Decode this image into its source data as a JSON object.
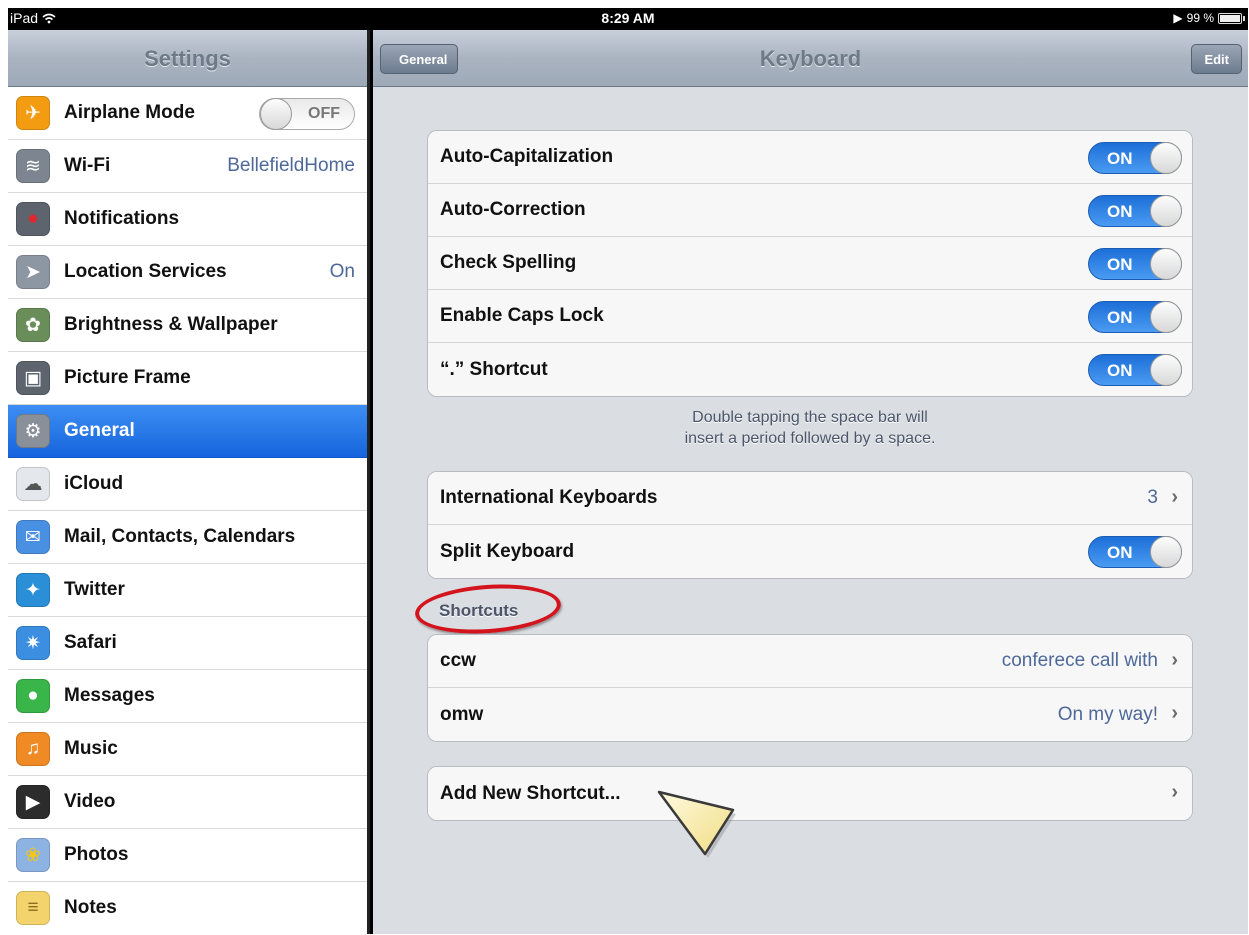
{
  "status_bar": {
    "device": "iPad",
    "time": "8:29 AM",
    "battery": "99 %"
  },
  "sidebar": {
    "title": "Settings",
    "airplane_switch": "OFF",
    "items": [
      {
        "label": "Airplane Mode",
        "icon": "airplane-icon",
        "icon_glyph": "✈",
        "bg": "#f39c12"
      },
      {
        "label": "Wi-Fi",
        "value": "BellefieldHome",
        "icon": "wifi-icon",
        "icon_glyph": "≋",
        "bg": "#7d8590"
      },
      {
        "label": "Notifications",
        "icon": "notifications-icon",
        "icon_glyph": "●",
        "bg": "#c9242b"
      },
      {
        "label": "Location Services",
        "value": "On",
        "icon": "location-icon",
        "icon_glyph": "➤",
        "bg": "#8d96a3"
      },
      {
        "label": "Brightness & Wallpaper",
        "icon": "brightness-icon",
        "icon_glyph": "✿",
        "bg": "#6a8e5a"
      },
      {
        "label": "Picture Frame",
        "icon": "picture-frame-icon",
        "icon_glyph": "▣",
        "bg": "#5d646e"
      },
      {
        "label": "General",
        "icon": "gear-icon",
        "icon_glyph": "⚙",
        "bg": "#8a9099"
      },
      {
        "label": "iCloud",
        "icon": "cloud-icon",
        "icon_glyph": "☁",
        "bg": "#c5cad1"
      },
      {
        "label": "Mail, Contacts, Calendars",
        "icon": "mail-icon",
        "icon_glyph": "✉",
        "bg": "#4a90e2"
      },
      {
        "label": "Twitter",
        "icon": "twitter-icon",
        "icon_glyph": "✦",
        "bg": "#2a8fd6"
      },
      {
        "label": "Safari",
        "icon": "safari-icon",
        "icon_glyph": "✷",
        "bg": "#3b8ee0"
      },
      {
        "label": "Messages",
        "icon": "messages-icon",
        "icon_glyph": "●",
        "bg": "#39b54a"
      },
      {
        "label": "Music",
        "icon": "music-icon",
        "icon_glyph": "♫",
        "bg": "#f08a24"
      },
      {
        "label": "Video",
        "icon": "video-icon",
        "icon_glyph": "▶",
        "bg": "#2c2c2c"
      },
      {
        "label": "Photos",
        "icon": "photos-icon",
        "icon_glyph": "❀",
        "bg": "#8db3e2"
      },
      {
        "label": "Notes",
        "icon": "notes-icon",
        "icon_glyph": "≡",
        "bg": "#f3d36b"
      }
    ]
  },
  "main": {
    "title": "Keyboard",
    "back_label": "General",
    "edit_label": "Edit",
    "toggles": [
      {
        "label": "Auto-Capitalization",
        "state": "ON"
      },
      {
        "label": "Auto-Correction",
        "state": "ON"
      },
      {
        "label": "Check Spelling",
        "state": "ON"
      },
      {
        "label": "Enable Caps Lock",
        "state": "ON"
      },
      {
        "label": "“.” Shortcut",
        "state": "ON"
      }
    ],
    "footnote_line1": "Double tapping the space bar will",
    "footnote_line2": "insert a period followed by a space.",
    "international_label": "International Keyboards",
    "international_value": "3",
    "split_label": "Split Keyboard",
    "split_state": "ON",
    "shortcuts_header": "Shortcuts",
    "shortcuts": [
      {
        "label": "ccw",
        "value": "conferece call with"
      },
      {
        "label": "omw",
        "value": "On my way!"
      }
    ],
    "add_shortcut_label": "Add New Shortcut..."
  }
}
